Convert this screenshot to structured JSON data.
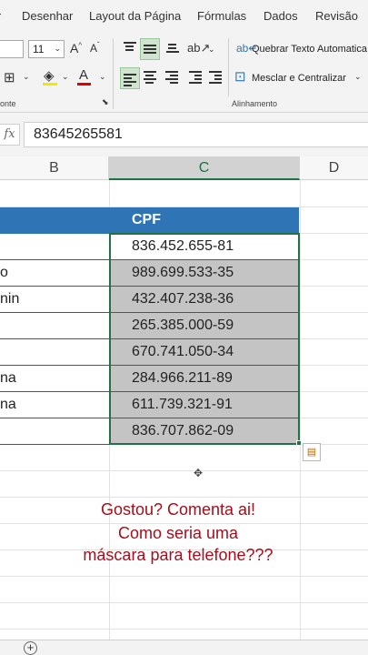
{
  "menu": {
    "tabs": [
      "ir",
      "Desenhar",
      "Layout da Página",
      "Fórmulas",
      "Dados",
      "Revisão"
    ]
  },
  "ribbon": {
    "font_size": "11",
    "font_group_label": "onte",
    "wrap_text_label": "Quebrar Texto Automatica",
    "merge_center_label": "Mesclar e Centralizar",
    "alignment_group_label": "Alinhamento"
  },
  "formula_bar": {
    "fx_label": "fx",
    "value": "83645265581"
  },
  "columns": [
    "B",
    "C",
    "D"
  ],
  "table": {
    "header": "CPF",
    "b_fragments": [
      "",
      "o",
      "nin",
      "",
      "",
      "na",
      "na",
      ""
    ],
    "cpf_values": [
      "836.452.655-81",
      "989.699.533-35",
      "432.407.238-36",
      "265.385.000-59",
      "670.741.050-34",
      "284.966.211-89",
      "611.739.321-91",
      "836.707.862-09"
    ]
  },
  "message": {
    "line1": "Gostou? Comenta ai!",
    "line2": "Como seria uma",
    "line3": "máscara para telefone???"
  },
  "colors": {
    "header_blue": "#2f75b5",
    "excel_green": "#217346",
    "message_red": "#a50e1a",
    "shaded_cell": "#c4c4c4"
  },
  "icons": [
    "add-sheet-icon",
    "quick-analysis-icon",
    "cursor-crosshair-icon",
    "wrap-text-icon",
    "merge-center-icon"
  ]
}
